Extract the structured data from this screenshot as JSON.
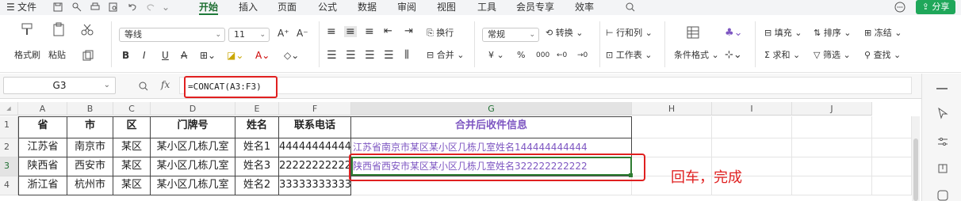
{
  "menu": {
    "hamburger": "☰",
    "file": "文件",
    "tabs": [
      "开始",
      "插入",
      "页面",
      "公式",
      "数据",
      "审阅",
      "视图",
      "工具",
      "会员专享",
      "效率"
    ],
    "active_tab": "开始",
    "share": "分享"
  },
  "ribbon": {
    "format_painter": "格式刷",
    "paste": "粘贴",
    "font_name": "等线",
    "font_size": "11",
    "bold": "B",
    "italic": "I",
    "underline": "U",
    "strike": "A",
    "wrap": "换行",
    "number_format": "常规",
    "convert": "转换",
    "rows_cols": "行和列",
    "merge": "合并",
    "currency": "¥",
    "percent": "%",
    "thousands": "000",
    "inc_dec": "←0",
    "dec_dec": "→0",
    "worksheet": "工作表",
    "cond_format": "条件格式",
    "fill": "填充",
    "sort": "排序",
    "freeze": "冻结",
    "sum": "求和",
    "filter": "筛选",
    "find": "查找"
  },
  "formula_bar": {
    "name_box": "G3",
    "fx": "fx",
    "formula": "=CONCAT(A3:F3)"
  },
  "columns": [
    "A",
    "B",
    "C",
    "D",
    "E",
    "F",
    "G",
    "H",
    "I",
    "J"
  ],
  "row_numbers": [
    "1",
    "2",
    "3",
    "4"
  ],
  "rows": [
    [
      "省",
      "市",
      "区",
      "门牌号",
      "姓名",
      "联系电话",
      "合并后收件信息"
    ],
    [
      "江苏省",
      "南京市",
      "某区",
      "某小区几栋几室",
      "姓名1",
      "44444444444",
      "江苏省南京市某区某小区几栋几室姓名144444444444"
    ],
    [
      "陕西省",
      "西安市",
      "某区",
      "某小区几栋几室",
      "姓名3",
      "22222222222",
      "陕西省西安市某区某小区几栋几室姓名322222222222"
    ],
    [
      "浙江省",
      "杭州市",
      "某区",
      "某小区几栋几室",
      "姓名2",
      "33333333333",
      ""
    ]
  ],
  "annotation": "回车，完成",
  "colors": {
    "accent": "#1f7a3a",
    "share": "#1fa75a",
    "highlight": "#e02020",
    "merged_text": "#7e57c2"
  }
}
